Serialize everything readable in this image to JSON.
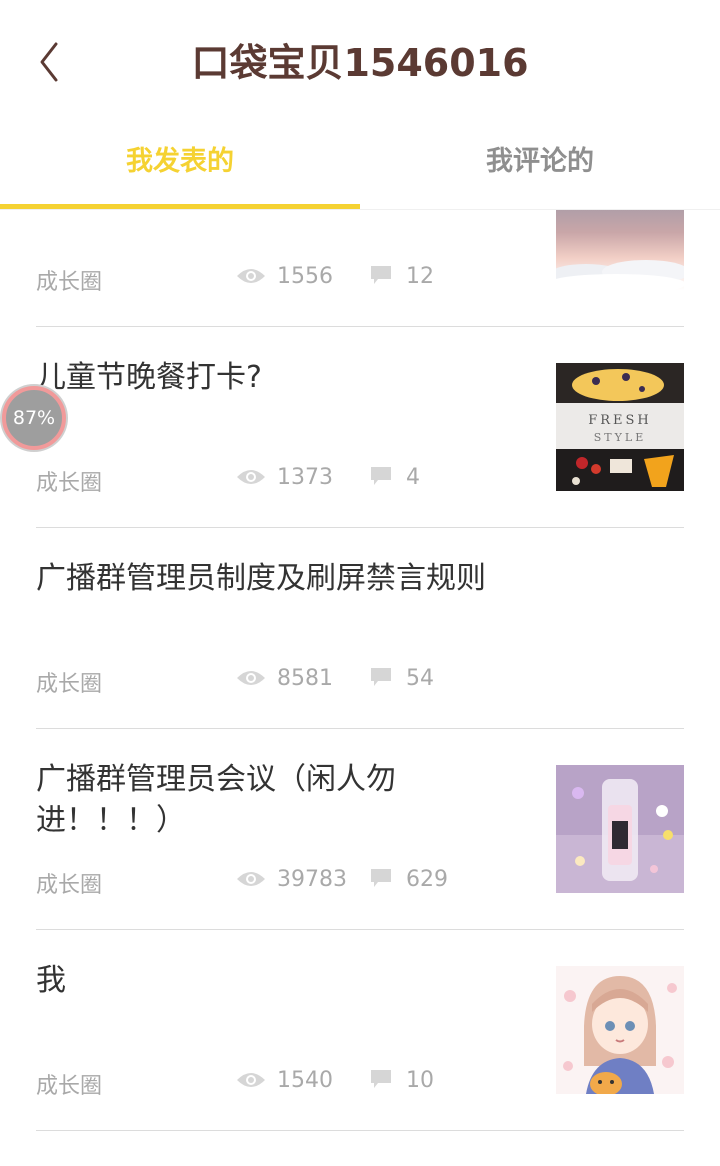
{
  "header": {
    "title": "口袋宝贝1546016",
    "back_icon": "chevron-left-icon"
  },
  "tabs": [
    {
      "label": "我发表的",
      "active": true
    },
    {
      "label": "我评论的",
      "active": false
    }
  ],
  "posts": [
    {
      "title": "",
      "category": "成长圈",
      "views": "1556",
      "comments": "12",
      "thumb": "clouds"
    },
    {
      "title": "儿童节晚餐打卡?",
      "category": "成长圈",
      "views": "1373",
      "comments": "4",
      "thumb": "food",
      "thumb_text": "FRESH STYLE"
    },
    {
      "title": "广播群管理员制度及刷屏禁言规则",
      "category": "成长圈",
      "views": "8581",
      "comments": "54",
      "thumb": "none"
    },
    {
      "title": "广播群管理员会议（闲人勿进！！！）",
      "category": "成长圈",
      "views": "39783",
      "comments": "629",
      "thumb": "bottle"
    },
    {
      "title": "我",
      "category": "成长圈",
      "views": "1540",
      "comments": "10",
      "thumb": "anime-girl"
    }
  ],
  "badge": {
    "text": "87%"
  },
  "colors": {
    "accent": "#f5d232",
    "title": "#5b3a33",
    "meta": "#a9a9a9",
    "badge_ring": "#f19a9a"
  }
}
